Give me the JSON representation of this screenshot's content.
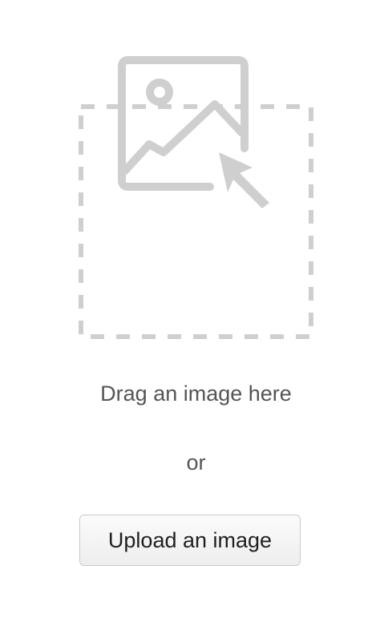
{
  "dropzone": {
    "drag_text": "Drag an image here",
    "or_text": "or",
    "icon": "image-cursor-icon"
  },
  "upload": {
    "button_label": "Upload an image"
  },
  "colors": {
    "icon_gray": "#cfcfcf",
    "text_gray": "#555555"
  }
}
